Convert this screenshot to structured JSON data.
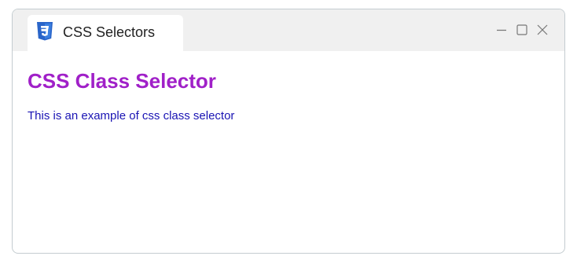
{
  "window": {
    "tab_title": "CSS Selectors",
    "tab_icon": "css3-icon",
    "controls": {
      "minimize_icon": "minimize-icon",
      "maximize_icon": "maximize-icon",
      "close_icon": "close-icon"
    }
  },
  "page": {
    "heading": "CSS Class Selector",
    "paragraph": "This is an example of css class selector"
  },
  "colors": {
    "heading": "#a020c8",
    "paragraph": "#1a14b4",
    "css_icon": "#2a65c9",
    "titlebar": "#f0f0f0"
  }
}
